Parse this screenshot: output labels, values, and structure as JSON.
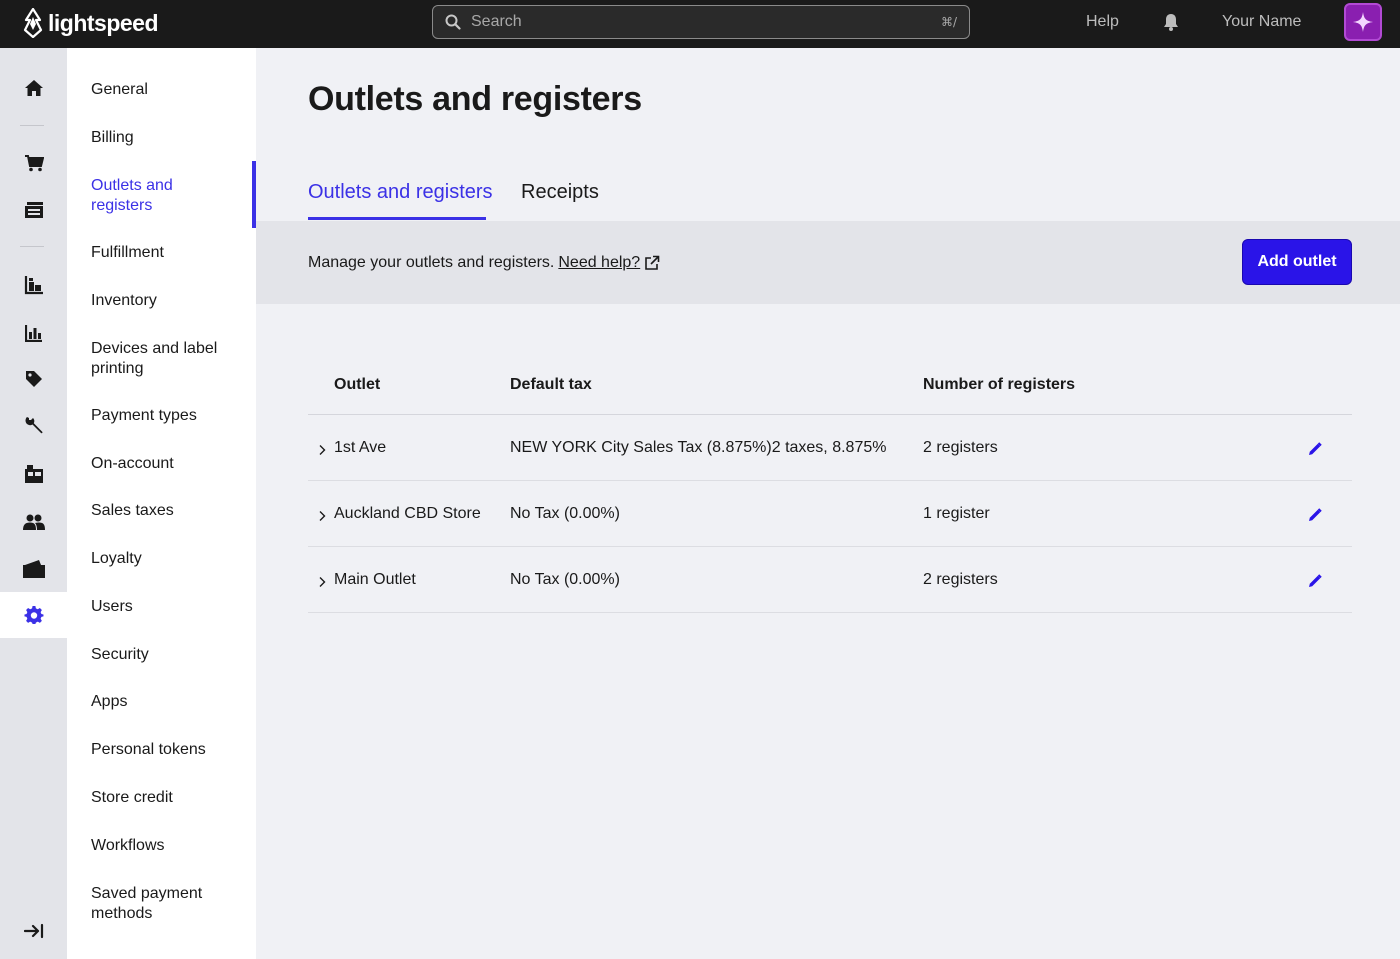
{
  "brand": {
    "name": "lightspeed"
  },
  "header": {
    "search_placeholder": "Search",
    "search_shortcut": "⌘/",
    "help_label": "Help",
    "user_name": "Your Name"
  },
  "rail": {
    "items": [
      {
        "icon": "home-icon"
      },
      {
        "icon": "cart-icon"
      },
      {
        "icon": "register-icon"
      },
      {
        "icon": "warehouse-icon"
      },
      {
        "icon": "reports-icon"
      },
      {
        "icon": "tag-icon"
      },
      {
        "icon": "wrench-icon"
      },
      {
        "icon": "store-icon"
      },
      {
        "icon": "customers-icon"
      },
      {
        "icon": "wallet-icon"
      },
      {
        "icon": "settings-icon",
        "active": true
      },
      {
        "icon": "expand-icon"
      }
    ]
  },
  "sidebar": {
    "items": [
      {
        "label": "General"
      },
      {
        "label": "Billing"
      },
      {
        "label": "Outlets and registers",
        "active": true
      },
      {
        "label": "Fulfillment"
      },
      {
        "label": "Inventory"
      },
      {
        "label": "Devices and label printing"
      },
      {
        "label": "Payment types"
      },
      {
        "label": "On-account"
      },
      {
        "label": "Sales taxes"
      },
      {
        "label": "Loyalty"
      },
      {
        "label": "Users"
      },
      {
        "label": "Security"
      },
      {
        "label": "Apps"
      },
      {
        "label": "Personal tokens"
      },
      {
        "label": "Store credit"
      },
      {
        "label": "Workflows"
      },
      {
        "label": "Saved payment methods"
      }
    ]
  },
  "main": {
    "title": "Outlets and registers",
    "tabs": [
      {
        "label": "Outlets and registers",
        "active": true
      },
      {
        "label": "Receipts"
      }
    ],
    "banner": {
      "text": "Manage your outlets and registers.",
      "link": "Need help?",
      "button": "Add outlet"
    },
    "table": {
      "columns": [
        "Outlet",
        "Default tax",
        "Number of registers"
      ],
      "rows": [
        {
          "outlet": "1st Ave",
          "tax": "NEW YORK City Sales Tax (8.875%)2 taxes, 8.875%",
          "registers": "2 registers"
        },
        {
          "outlet": "Auckland CBD Store",
          "tax": "No Tax (0.00%)",
          "registers": "1 register"
        },
        {
          "outlet": "Main Outlet",
          "tax": "No Tax (0.00%)",
          "registers": "2 registers"
        }
      ]
    }
  },
  "colors": {
    "accent": "#3b31e6",
    "button": "#2a14e8",
    "topbar": "#1a1a1a",
    "avatar": "#8a1fb0"
  }
}
